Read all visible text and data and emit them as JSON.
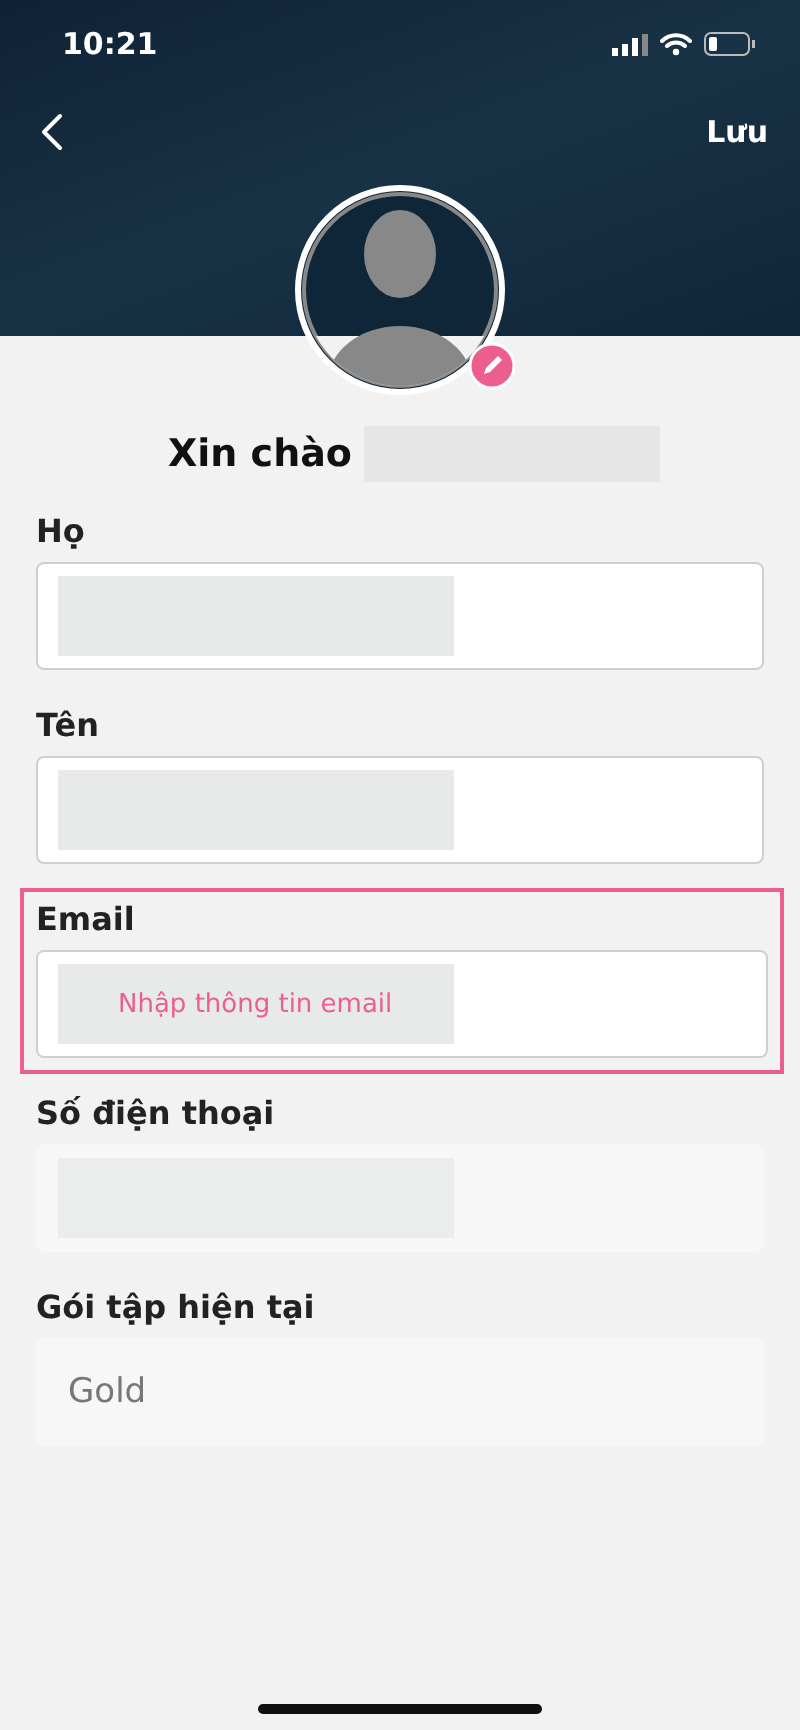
{
  "status_bar": {
    "time": "10:21"
  },
  "header": {
    "save": "Lưu"
  },
  "profile": {
    "greeting": "Xin chào",
    "name_redacted": true
  },
  "fields": [
    {
      "label": "Họ",
      "redacted": true,
      "highlighted": false,
      "disabled": false
    },
    {
      "label": "Tên",
      "redacted": true,
      "highlighted": false,
      "disabled": false
    },
    {
      "label": "Email",
      "redacted": true,
      "highlighted": true,
      "disabled": false,
      "placeholder": "Nhập thông tin email"
    },
    {
      "label": "Số điện thoại",
      "redacted": true,
      "highlighted": false,
      "disabled": true
    },
    {
      "label": "Gói tập hiện tại",
      "redacted": false,
      "highlighted": false,
      "disabled": true,
      "value": "Gold"
    }
  ]
}
